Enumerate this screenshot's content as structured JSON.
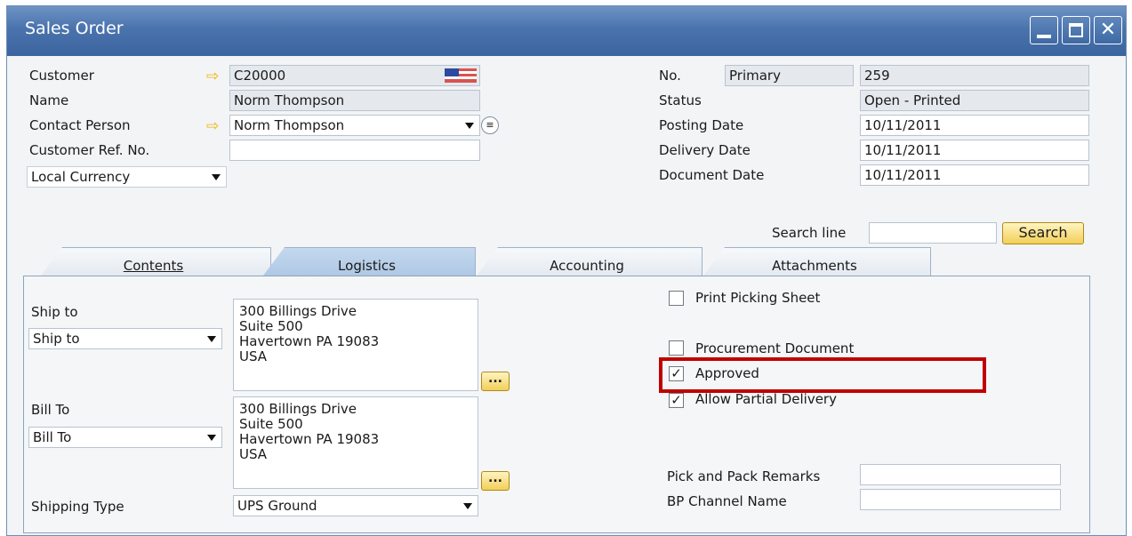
{
  "window": {
    "title": "Sales Order"
  },
  "header": {
    "customer_label": "Customer",
    "customer_value": "C20000",
    "name_label": "Name",
    "name_value": "Norm Thompson",
    "contact_label": "Contact Person",
    "contact_value": "Norm Thompson",
    "custref_label": "Customer Ref. No.",
    "custref_value": "",
    "currency_value": "Local Currency",
    "no_label": "No.",
    "series_value": "Primary",
    "no_value": "259",
    "status_label": "Status",
    "status_value": "Open - Printed",
    "posting_label": "Posting Date",
    "posting_value": "10/11/2011",
    "delivery_label": "Delivery Date",
    "delivery_value": "10/11/2011",
    "document_label": "Document Date",
    "document_value": "10/11/2011"
  },
  "search": {
    "label": "Search line",
    "value": "",
    "button": "Search"
  },
  "tabs": [
    {
      "label": "Contents"
    },
    {
      "label": "Logistics"
    },
    {
      "label": "Accounting"
    },
    {
      "label": "Attachments"
    }
  ],
  "logistics": {
    "shipto_label": "Ship to",
    "shipto_select": "Ship to",
    "shipto_address": [
      "300 Billings Drive",
      "Suite 500",
      "Havertown PA  19083",
      "USA"
    ],
    "billto_label": "Bill To",
    "billto_select": "Bill To",
    "billto_address": [
      "300 Billings Drive",
      "Suite 500",
      "Havertown PA  19083",
      "USA"
    ],
    "shipping_type_label": "Shipping Type",
    "shipping_type_value": "UPS Ground",
    "dots": "...",
    "print_picking_label": "Print Picking Sheet",
    "procurement_label": "Procurement Document",
    "approved_label": "Approved",
    "partial_label": "Allow Partial Delivery",
    "pick_remarks_label": "Pick and Pack Remarks",
    "pick_remarks_value": "",
    "bp_channel_label": "BP Channel Name",
    "bp_channel_value": "",
    "checks": {
      "print_picking": false,
      "procurement": false,
      "approved": true,
      "partial": true
    },
    "check_mark": "✓"
  },
  "colors": {
    "title_bar": "#4a73ad",
    "highlight": "#c00000",
    "button": "#f2cf5a"
  }
}
